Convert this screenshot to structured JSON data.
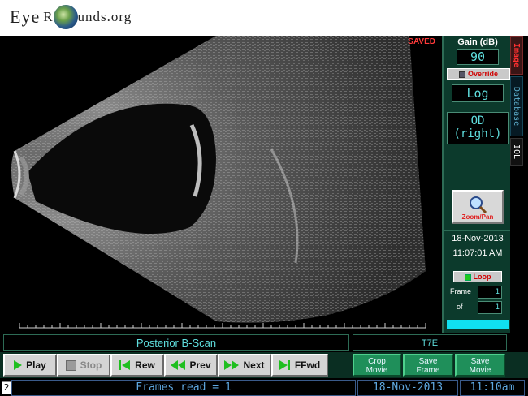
{
  "logo": {
    "text_before": "Eye",
    "text_mid": "R",
    "text_after": "unds",
    "text_tld": ".org"
  },
  "scan": {
    "saved_label": "SAVED"
  },
  "right_panel": {
    "gain_label": "Gain (dB)",
    "gain_value": "90",
    "override_label": "Override",
    "mode_value": "Log",
    "eye_line1": "OD",
    "eye_line2": "(right)",
    "zoom_button_label": "Zoom/Pan",
    "date": "18-Nov-2013",
    "time": "11:07:01 AM",
    "loop_label": "Loop",
    "frame_label": "Frame",
    "of_label": "of",
    "frame_value": "1",
    "of_value": "1"
  },
  "tabs": {
    "image": "Image",
    "database": "Database",
    "iol": "IOL"
  },
  "labels": {
    "scan_type": "Posterior B-Scan",
    "probe": "T7E"
  },
  "playback": {
    "play": "Play",
    "stop": "Stop",
    "rew": "Rew",
    "prev": "Prev",
    "next": "Next",
    "ffwd": "FFwd"
  },
  "movie": {
    "crop_line1": "Crop",
    "crop_line2": "Movie",
    "save_frame_line1": "Save",
    "save_frame_line2": "Frame",
    "save_movie_line1": "Save",
    "save_movie_line2": "Movie"
  },
  "status": {
    "index": "2",
    "frames_read": "Frames read = 1",
    "date": "18-Nov-2013",
    "time": "11:10am"
  },
  "colors": {
    "panel_bg": "#0c3a2c",
    "lcd_text": "#5fdede",
    "alert_red": "#ff3a3a",
    "status_blue": "#5fa8e0"
  }
}
